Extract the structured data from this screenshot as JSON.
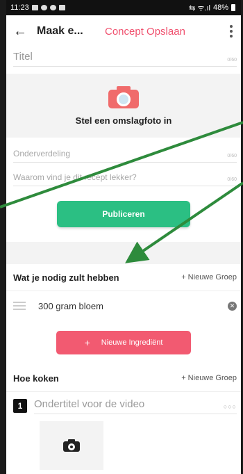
{
  "statusbar": {
    "time": "11:23",
    "signal": "⇆ ᯤ.ıl",
    "battery": "48%"
  },
  "appbar": {
    "back_icon": "←",
    "title": "Maak e...",
    "draft_save": "Concept Opslaan"
  },
  "form": {
    "title_placeholder": "Titel",
    "title_count": "0/60",
    "cover_label": "Stel een omslagfoto in",
    "subtitle_placeholder": "Onderverdeling",
    "subtitle_count": "0/60",
    "why_placeholder": "Waarom vind je dit recept lekker?",
    "why_count": "0/60",
    "publish_label": "Publiceren"
  },
  "ingredients": {
    "heading": "Wat je nodig zult hebben",
    "new_group": "+ Nieuwe Groep",
    "items": [
      {
        "text": "300 gram bloem"
      }
    ],
    "add_label": "Nieuwe Ingrediënt",
    "add_plus": "+"
  },
  "steps": {
    "heading": "Hoe koken",
    "new_group": "+ Nieuwe Groep",
    "items": [
      {
        "number": "1",
        "placeholder": "Ondertitel voor de video",
        "more": "○○○"
      }
    ]
  },
  "colors": {
    "accent_red": "#f0506e",
    "publish_green": "#2bbf83",
    "annotation_arrow": "#2e8b3c"
  }
}
